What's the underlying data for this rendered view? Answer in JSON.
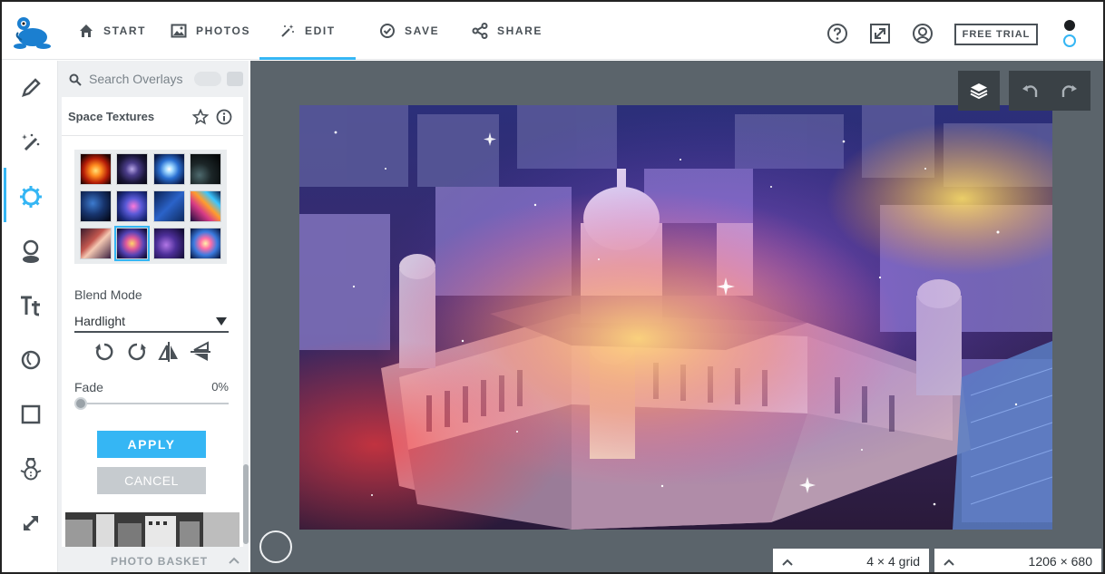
{
  "nav": {
    "start": "START",
    "photos": "PHOTOS",
    "edit": "EDIT",
    "save": "SAVE",
    "share": "SHARE",
    "free_trial": "FREE TRIAL"
  },
  "panel": {
    "search_placeholder": "Search Overlays",
    "section_title": "Space Textures",
    "blend_mode_label": "Blend Mode",
    "blend_mode_value": "Hardlight",
    "fade_label": "Fade",
    "fade_value": "0%",
    "fade_fraction": 0.0,
    "apply_label": "APPLY",
    "cancel_label": "CANCEL",
    "photo_basket_label": "PHOTO BASKET",
    "selected_texture_index": 9
  },
  "status": {
    "grid": "4 × 4  grid",
    "size": "1206 × 680"
  },
  "colors": {
    "accent": "#35b6f4",
    "workspace": "#5b646b",
    "text": "#4a5157"
  }
}
